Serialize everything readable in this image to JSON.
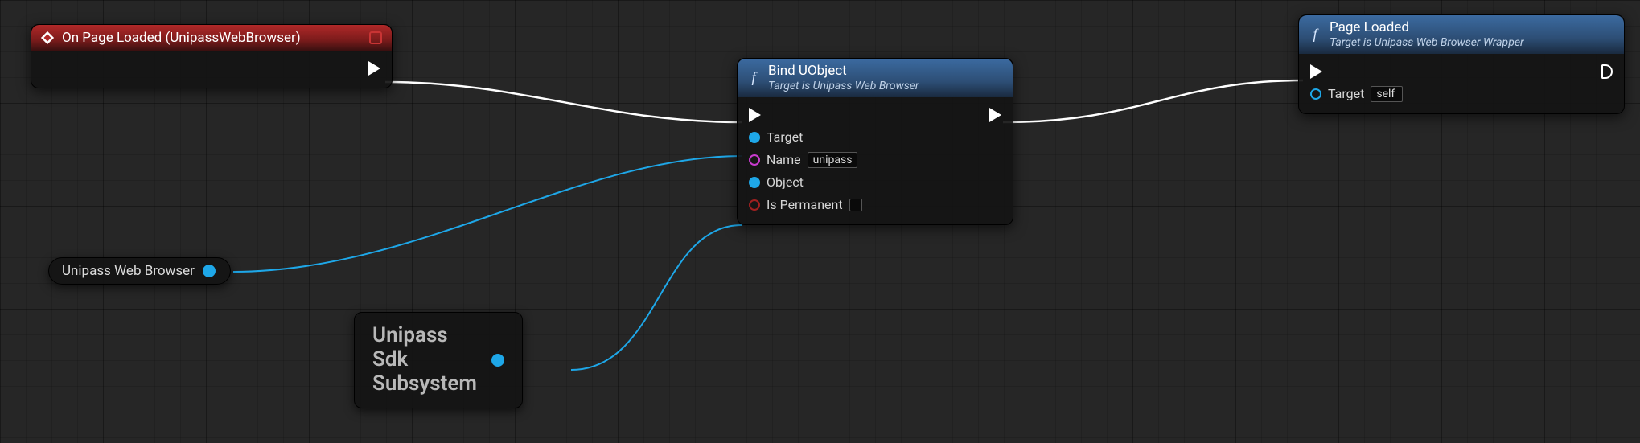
{
  "nodes": {
    "event": {
      "title": "On Page Loaded (UnipassWebBrowser)"
    },
    "bind": {
      "title": "Bind UObject",
      "subtitle": "Target is Unipass Web Browser",
      "pins": {
        "target": "Target",
        "name": "Name",
        "name_value": "unipass",
        "object": "Object",
        "is_permanent": "Is Permanent"
      }
    },
    "page_loaded": {
      "title": "Page Loaded",
      "subtitle": "Target is Unipass Web Browser Wrapper",
      "pins": {
        "target": "Target",
        "target_value": "self"
      }
    },
    "variable": {
      "label": "Unipass Web Browser"
    },
    "subsystem": {
      "label_line1": "Unipass",
      "label_line2": "Sdk",
      "label_line3": "Subsystem"
    }
  },
  "colors": {
    "exec_wire": "#ffffff",
    "obj_wire": "#1ea7e8"
  }
}
